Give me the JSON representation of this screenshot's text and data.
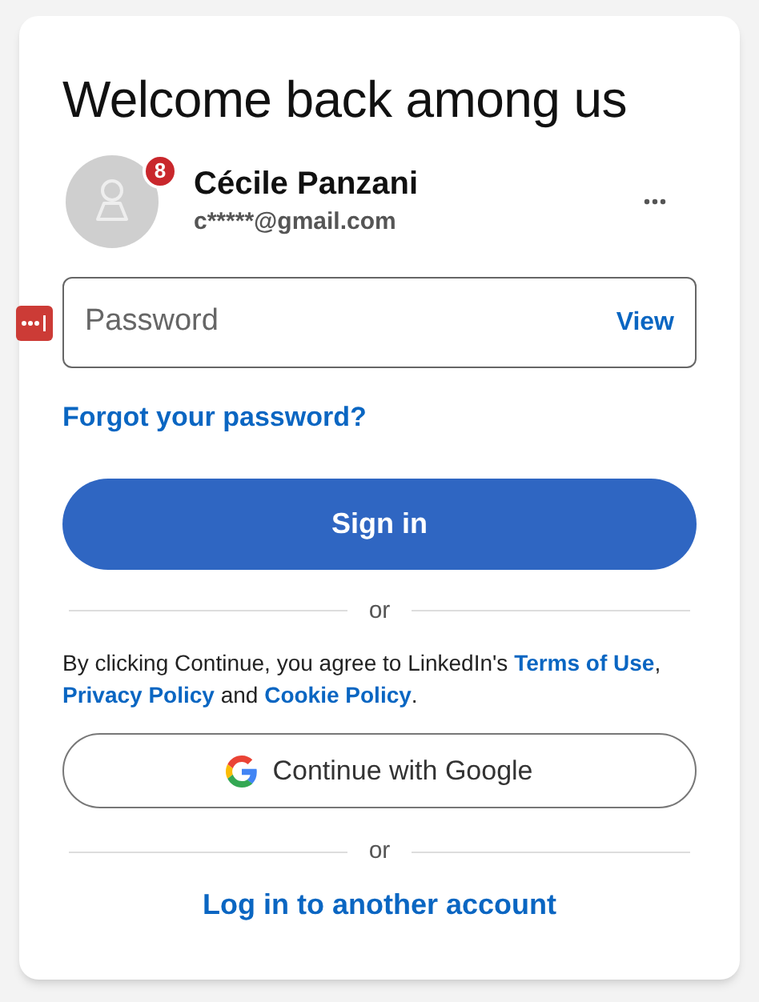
{
  "title": "Welcome back among us",
  "account": {
    "name": "Cécile Panzani",
    "email": "c*****@gmail.com",
    "badge": "8"
  },
  "password": {
    "placeholder": "Password",
    "toggle": "View"
  },
  "forgot_link": "Forgot your password?",
  "sign_in_button": "Sign in",
  "separator_1": "or",
  "legal": [
    {
      "kind": "text",
      "text": "By clicking Continue, you agree to LinkedIn's "
    },
    {
      "kind": "link",
      "text": "Terms of Use"
    },
    {
      "kind": "text",
      "text": ", "
    },
    {
      "kind": "link",
      "text": "Privacy Policy"
    },
    {
      "kind": "text",
      "text": " and "
    },
    {
      "kind": "link",
      "text": "Cookie Policy"
    },
    {
      "kind": "text",
      "text": "."
    }
  ],
  "google_button": "Continue with Google",
  "separator_2": "or",
  "other_account_link": "Log in to another account"
}
